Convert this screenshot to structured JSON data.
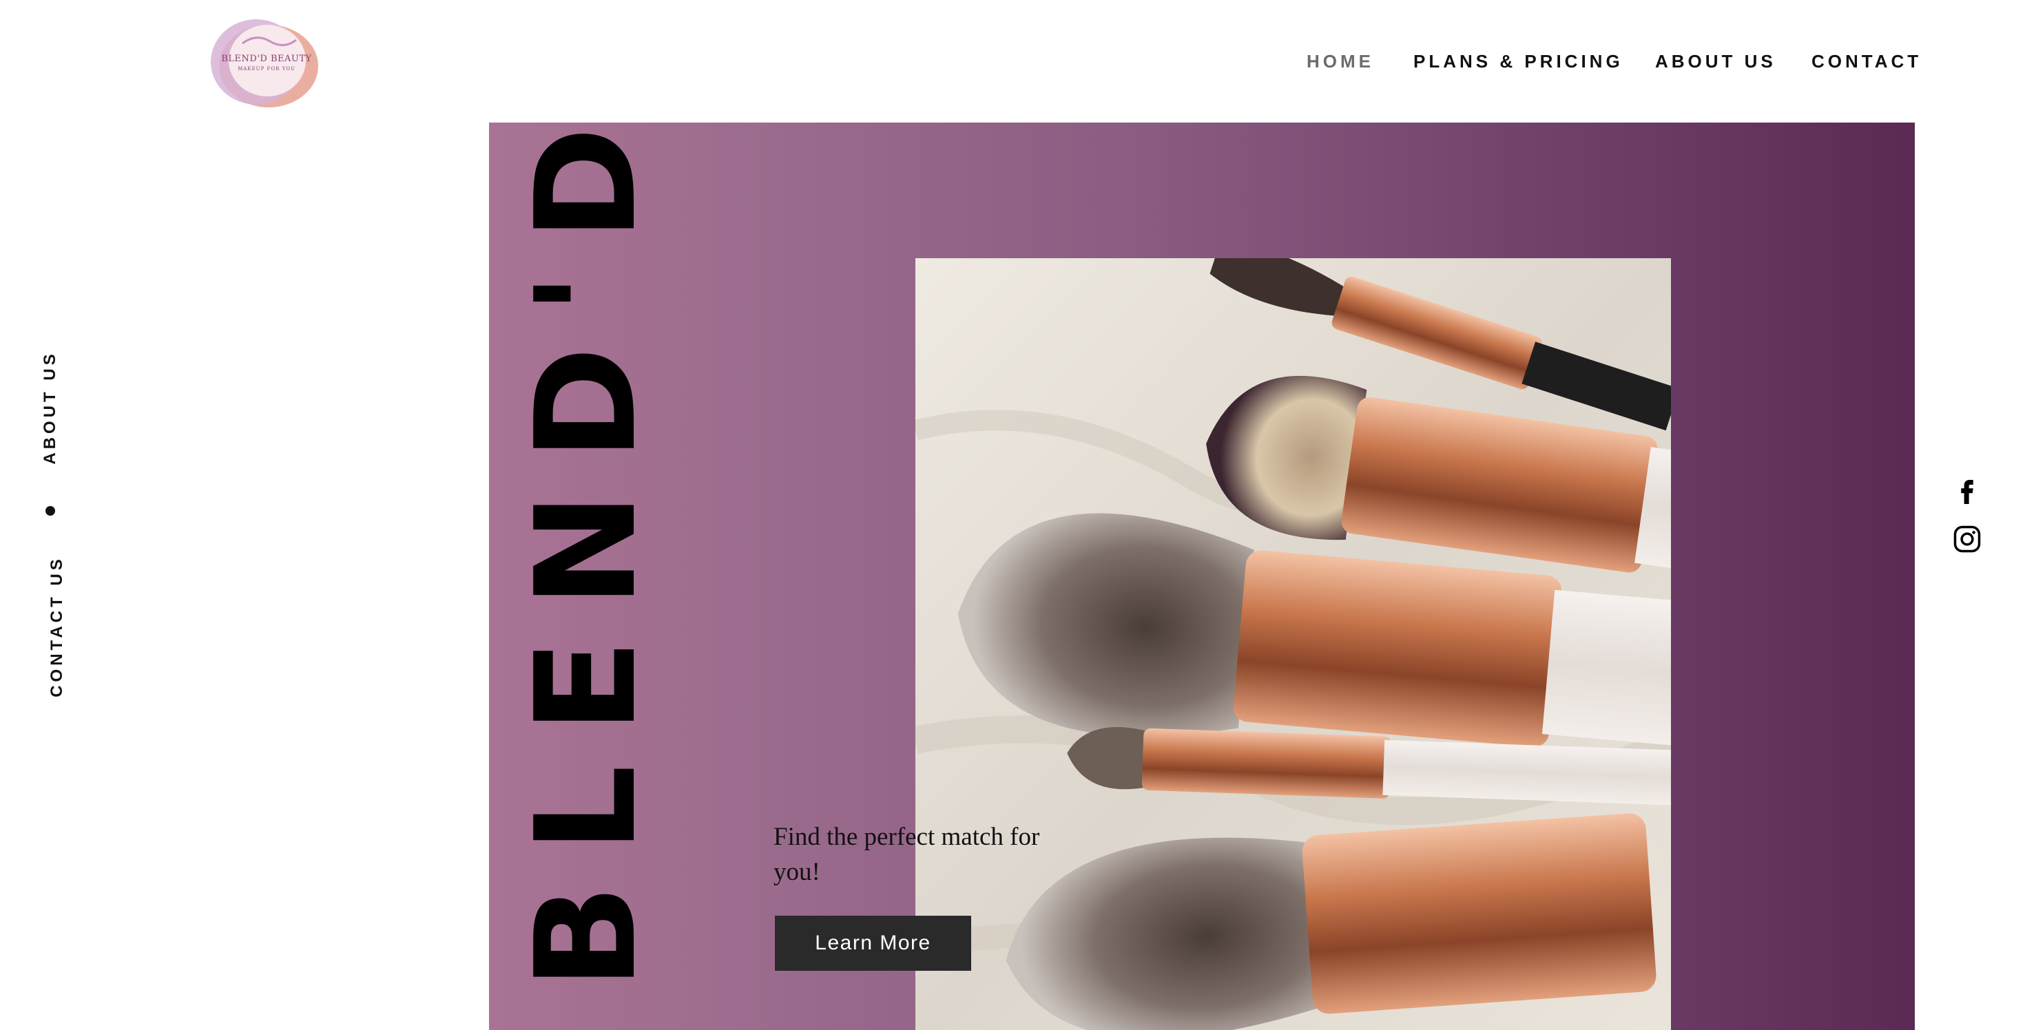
{
  "brand": {
    "logo_title": "BLEND'D BEAUTY",
    "logo_subtitle": "MAKEUP FOR YOU"
  },
  "nav": {
    "items": [
      {
        "label": "HOME",
        "active": true
      },
      {
        "label": "PLANS & PRICING"
      },
      {
        "label": "ABOUT US"
      },
      {
        "label": "CONTACT"
      }
    ]
  },
  "side_nav": {
    "about": "ABOUT US",
    "contact": "CONTACT US"
  },
  "hero": {
    "title": "BLEND'D",
    "tagline": "Find the perfect match for you!",
    "button_label": "Learn More"
  },
  "social": {
    "icons": [
      "facebook-icon",
      "instagram-icon"
    ]
  },
  "colors": {
    "gradient_start": "#a97394",
    "gradient_end": "#5b2a54",
    "button": "#2a2a2b",
    "nav_active": "#6b6b6b"
  }
}
